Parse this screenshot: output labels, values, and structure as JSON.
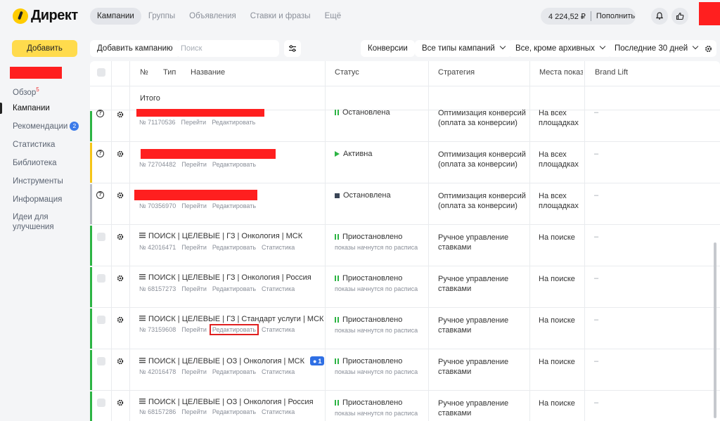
{
  "header": {
    "logo_text": "Директ",
    "nav": [
      {
        "label": "Кампании",
        "active": true
      },
      {
        "label": "Группы",
        "active": false
      },
      {
        "label": "Объявления",
        "active": false
      },
      {
        "label": "Ставки и фразы",
        "active": false
      },
      {
        "label": "Ещё",
        "active": false
      }
    ],
    "balance": "4 224,52 ₽",
    "top_up": "Пополнить",
    "icons": [
      "bell-icon",
      "thumbs-up-icon"
    ]
  },
  "sidebar": {
    "add_label": "Добавить",
    "items": [
      {
        "label": "Обзор",
        "sup": "5"
      },
      {
        "label": "Кампании",
        "active": true
      },
      {
        "label": "Рекомендации",
        "badge": "2"
      },
      {
        "label": "Статистика"
      },
      {
        "label": "Библиотека"
      },
      {
        "label": "Инструменты"
      },
      {
        "label": "Информация"
      },
      {
        "label": "Идеи для улучшения"
      }
    ]
  },
  "toolbar": {
    "add_campaign": "Добавить кампанию",
    "search_placeholder": "Поиск",
    "conversions": "Конверсии",
    "types": "Все типы кампаний",
    "archive": "Все, кроме архивных",
    "period": "Последние 30 дней"
  },
  "table": {
    "headers": {
      "num": "№",
      "type": "Тип",
      "name": "Название",
      "status": "Статус",
      "strategy": "Стратегия",
      "places": "Места показ",
      "brandlift": "Brand Lift"
    },
    "total_label": "Итого",
    "row_links": {
      "go": "Перейти",
      "edit": "Редактировать",
      "stats": "Статистика"
    },
    "rows": [
      {
        "name": "",
        "id": "№ 71170536",
        "status": "Остановлена",
        "status_sub": "",
        "strategy": "Оптимизация конверсий (оплата за конверсии)",
        "places": "На всех площадках",
        "brandlift": "–",
        "has_stats": false
      },
      {
        "name": "",
        "id": "№ 72704482",
        "status": "Активна",
        "status_sub": "",
        "strategy": "Оптимизация конверсий (оплата за конверсии)",
        "places": "На всех площадках",
        "brandlift": "–",
        "has_stats": false
      },
      {
        "name": "",
        "id": "№ 70356970",
        "status": "Остановлена",
        "status_sub": "",
        "strategy": "Оптимизация конверсий (оплата за конверсии)",
        "places": "На всех площадках",
        "brandlift": "–",
        "has_stats": false
      },
      {
        "name": "ПОИСК | ЦЕЛЕВЫЕ | ГЗ | Онкология | МСК",
        "id": "№ 42016471",
        "status": "Приостановлено",
        "status_sub": "показы начнутся по расписа",
        "strategy": "Ручное управление ставками",
        "places": "На поиске",
        "brandlift": "–",
        "has_stats": true
      },
      {
        "name": "ПОИСК | ЦЕЛЕВЫЕ | ГЗ | Онкология | Россия",
        "id": "№ 68157273",
        "status": "Приостановлено",
        "status_sub": "показы начнутся по расписа",
        "strategy": "Ручное управление ставками",
        "places": "На поиске",
        "brandlift": "–",
        "has_stats": true
      },
      {
        "name": "ПОИСК | ЦЕЛЕВЫЕ | ГЗ | Стандарт услуги | МСК",
        "id": "№ 73159608",
        "status": "Приостановлено",
        "status_sub": "показы начнутся по расписа",
        "strategy": "Ручное управление ставками",
        "places": "На поиске",
        "brandlift": "–",
        "has_stats": true
      },
      {
        "name": "ПОИСК | ЦЕЛЕВЫЕ | ОЗ | Онкология | МСК",
        "id": "№ 42016478",
        "status": "Приостановлено",
        "status_sub": "показы начнутся по расписа",
        "strategy": "Ручное управление ставками",
        "places": "На поиске",
        "brandlift": "–",
        "has_stats": true,
        "badge": "1"
      },
      {
        "name": "ПОИСК | ЦЕЛЕВЫЕ | ОЗ | Онкология | Россия",
        "id": "№ 68157286",
        "status": "Приостановлено",
        "status_sub": "показы начнутся по расписа",
        "strategy": "Ручное управление ставками",
        "places": "На поиске",
        "brandlift": "–",
        "has_stats": true
      }
    ]
  },
  "colors": {
    "accent_yellow": "#ffdb4d",
    "status_green": "#2db444",
    "bar_green": "#2db444",
    "bar_yellow": "#f5c518",
    "bar_gray": "#b8bcc4",
    "redaction": "#ff1f1f"
  }
}
